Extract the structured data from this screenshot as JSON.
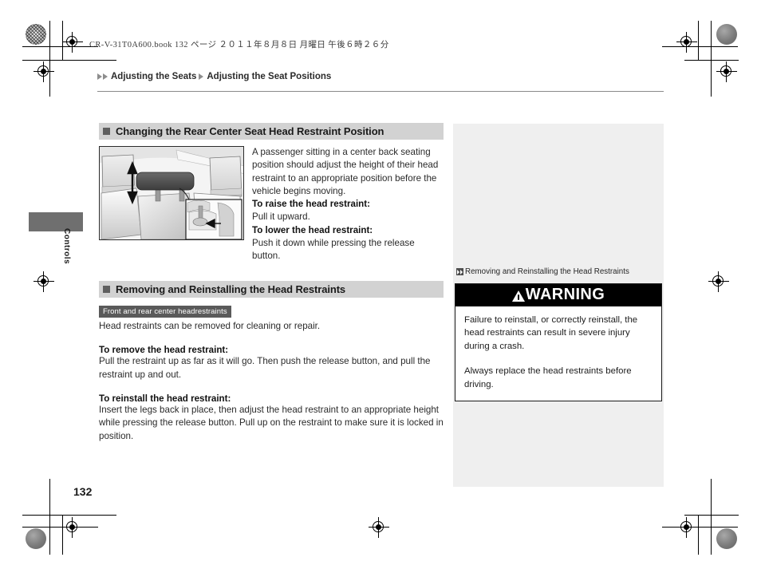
{
  "print": {
    "book_header": "CR-V-31T0A600.book   132 ページ   ２０１１年８月８日   月曜日   午後６時２６分"
  },
  "breadcrumb": {
    "level1": "Adjusting the Seats",
    "level2": "Adjusting the Seat Positions"
  },
  "side_tab": {
    "label": "Controls"
  },
  "main": {
    "section1": {
      "heading": "Changing the Rear Center Seat Head Restraint Position",
      "intro": "A passenger sitting in a center back seating position should adjust the height of their head restraint to an appropriate position before the vehicle begins moving.",
      "raise_label": "To raise the head restraint:",
      "raise_text": "Pull it upward.",
      "lower_label": "To lower the head restraint:",
      "lower_text": "Push it down while pressing the release button.",
      "figure_alt": "rear-seat-head-restraint-illustration"
    },
    "section2": {
      "heading": "Removing and Reinstalling the Head Restraints",
      "badge": "Front and rear center headrestraints",
      "intro": "Head restraints can be removed for cleaning or repair.",
      "remove_label": "To remove the head restraint:",
      "remove_text": "Pull the restraint up as far as it will go. Then push the release button, and pull the restraint up and out.",
      "reinstall_label": "To reinstall the head restraint:",
      "reinstall_text": "Insert the legs back in place, then adjust the head restraint to an appropriate height while pressing the release button. Pull up on the restraint to make sure it is locked in position."
    }
  },
  "sidebar": {
    "reference": "Removing and Reinstalling the Head Restraints",
    "warning": {
      "title": "WARNING",
      "paragraph1": "Failure to reinstall, or correctly reinstall, the head restraints can result in severe injury during a crash.",
      "paragraph2": "Always replace the head restraints before driving."
    }
  },
  "footer": {
    "page_number": "132"
  },
  "colors": {
    "section_heading_bg": "#d2d2d2",
    "badge_bg": "#5a5a5a",
    "sidebar_bg": "#efefef",
    "warning_bar_bg": "#000000",
    "tab_bg": "#6f6f6f"
  }
}
